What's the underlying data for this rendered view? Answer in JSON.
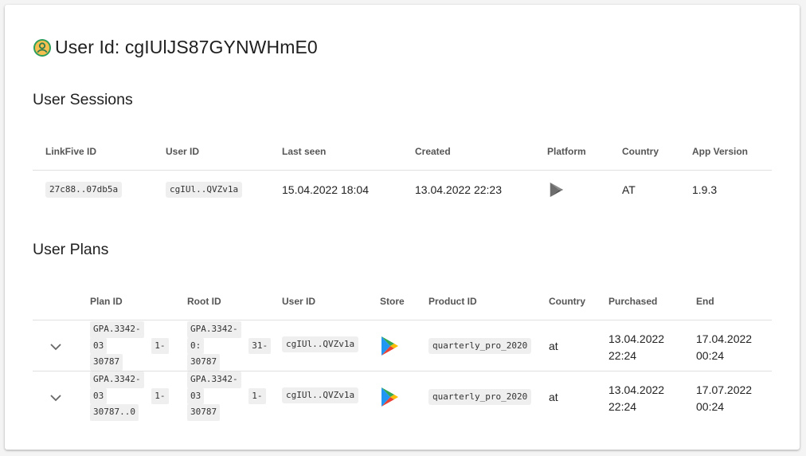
{
  "header": {
    "title": "User Id: cgIUlJS87GYNWHmE0",
    "icon": "account-circle-icon"
  },
  "sessions": {
    "title": "User Sessions",
    "columns": [
      "LinkFive ID",
      "User ID",
      "Last seen",
      "Created",
      "Platform",
      "Country",
      "App Version"
    ],
    "rows": [
      {
        "linkfive_id": "27c88..07db5a",
        "user_id": "cgIUl..QVZv1a",
        "last_seen": "15.04.2022 18:04",
        "created": "13.04.2022 22:23",
        "platform": "google-play-icon",
        "country": "AT",
        "app_version": "1.9.3"
      }
    ]
  },
  "plans": {
    "title": "User Plans",
    "columns": [
      "Plan ID",
      "Root ID",
      "User ID",
      "Store",
      "Product ID",
      "Country",
      "Purchased",
      "End"
    ],
    "rows": [
      {
        "plan_id": [
          "GPA.3342-",
          "03",
          "1-",
          "30787"
        ],
        "root_id": [
          "GPA.3342-",
          "0:",
          "31-",
          "30787"
        ],
        "user_id": "cgIUl..QVZv1a",
        "store": "google-play-icon",
        "product_id": "quarterly_pro_2020",
        "country": "at",
        "purchased": [
          "13.04.2022",
          "22:24"
        ],
        "end": [
          "17.04.2022",
          "00:24"
        ]
      },
      {
        "plan_id": [
          "GPA.3342-",
          "03",
          "1-",
          "30787..0"
        ],
        "root_id": [
          "GPA.3342-",
          "03",
          "1-",
          "30787"
        ],
        "user_id": "cgIUl..QVZv1a",
        "store": "google-play-icon",
        "product_id": "quarterly_pro_2020",
        "country": "at",
        "purchased": [
          "13.04.2022",
          "22:24"
        ],
        "end": [
          "17.07.2022",
          "00:24"
        ]
      }
    ]
  },
  "colors": {
    "accent_green": "#34a853",
    "icon_yellow": "#f5c04f"
  }
}
